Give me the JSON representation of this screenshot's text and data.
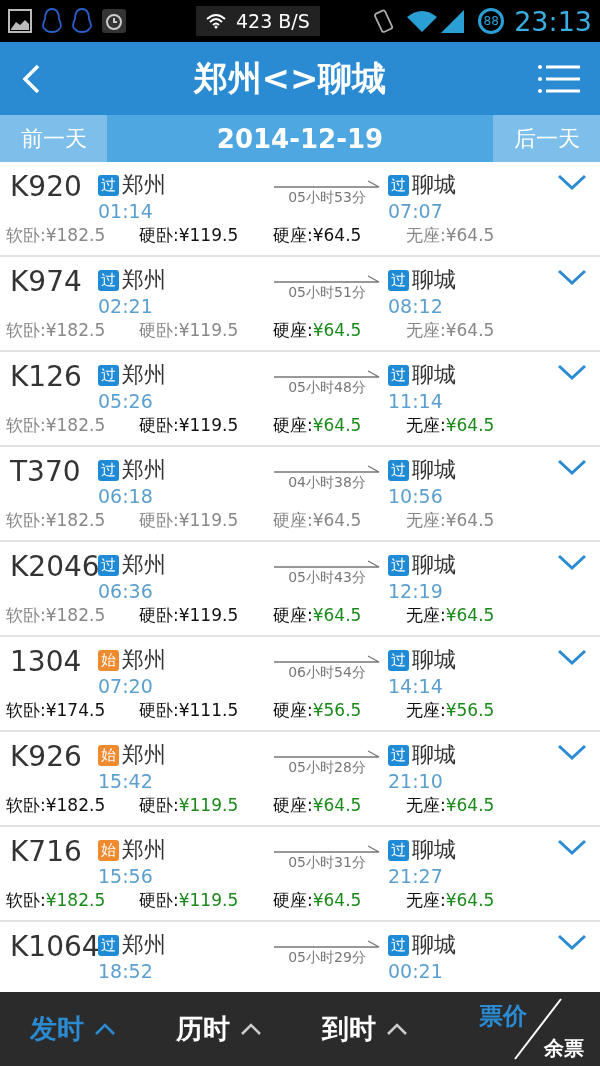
{
  "status_bar": {
    "speed": "423 B/S",
    "battery": "88",
    "time": "23:13"
  },
  "header": {
    "title": "郑州<>聊城"
  },
  "date_bar": {
    "prev": "前一天",
    "date": "2014-12-19",
    "next": "后一天"
  },
  "trains": [
    {
      "number": "K920",
      "from": {
        "badge": "过",
        "kind": "pass",
        "name": "郑州",
        "time": "01:14"
      },
      "duration": "05小时53分",
      "to": {
        "badge": "过",
        "kind": "pass",
        "name": "聊城",
        "time": "07:07"
      },
      "seats": [
        {
          "label": "软卧:",
          "price": "¥182.5",
          "kind": "none"
        },
        {
          "label": "硬卧:",
          "price": "¥119.5",
          "kind": "plain"
        },
        {
          "label": "硬座:",
          "price": "¥64.5",
          "kind": "plain"
        },
        {
          "label": "无座:",
          "price": "¥64.5",
          "kind": "none"
        }
      ]
    },
    {
      "number": "K974",
      "from": {
        "badge": "过",
        "kind": "pass",
        "name": "郑州",
        "time": "02:21"
      },
      "duration": "05小时51分",
      "to": {
        "badge": "过",
        "kind": "pass",
        "name": "聊城",
        "time": "08:12"
      },
      "seats": [
        {
          "label": "软卧:",
          "price": "¥182.5",
          "kind": "none"
        },
        {
          "label": "硬卧:",
          "price": "¥119.5",
          "kind": "none"
        },
        {
          "label": "硬座:",
          "price": "¥64.5",
          "kind": "available"
        },
        {
          "label": "无座:",
          "price": "¥64.5",
          "kind": "none"
        }
      ]
    },
    {
      "number": "K126",
      "from": {
        "badge": "过",
        "kind": "pass",
        "name": "郑州",
        "time": "05:26"
      },
      "duration": "05小时48分",
      "to": {
        "badge": "过",
        "kind": "pass",
        "name": "聊城",
        "time": "11:14"
      },
      "seats": [
        {
          "label": "软卧:",
          "price": "¥182.5",
          "kind": "none"
        },
        {
          "label": "硬卧:",
          "price": "¥119.5",
          "kind": "plain"
        },
        {
          "label": "硬座:",
          "price": "¥64.5",
          "kind": "available"
        },
        {
          "label": "无座:",
          "price": "¥64.5",
          "kind": "available"
        }
      ]
    },
    {
      "number": "T370",
      "from": {
        "badge": "过",
        "kind": "pass",
        "name": "郑州",
        "time": "06:18"
      },
      "duration": "04小时38分",
      "to": {
        "badge": "过",
        "kind": "pass",
        "name": "聊城",
        "time": "10:56"
      },
      "seats": [
        {
          "label": "软卧:",
          "price": "¥182.5",
          "kind": "none"
        },
        {
          "label": "硬卧:",
          "price": "¥119.5",
          "kind": "none"
        },
        {
          "label": "硬座:",
          "price": "¥64.5",
          "kind": "none"
        },
        {
          "label": "无座:",
          "price": "¥64.5",
          "kind": "none"
        }
      ]
    },
    {
      "number": "K2046",
      "from": {
        "badge": "过",
        "kind": "pass",
        "name": "郑州",
        "time": "06:36"
      },
      "duration": "05小时43分",
      "to": {
        "badge": "过",
        "kind": "pass",
        "name": "聊城",
        "time": "12:19"
      },
      "seats": [
        {
          "label": "软卧:",
          "price": "¥182.5",
          "kind": "none"
        },
        {
          "label": "硬卧:",
          "price": "¥119.5",
          "kind": "plain"
        },
        {
          "label": "硬座:",
          "price": "¥64.5",
          "kind": "available"
        },
        {
          "label": "无座:",
          "price": "¥64.5",
          "kind": "available"
        }
      ]
    },
    {
      "number": "1304",
      "from": {
        "badge": "始",
        "kind": "start",
        "name": "郑州",
        "time": "07:20"
      },
      "duration": "06小时54分",
      "to": {
        "badge": "过",
        "kind": "pass",
        "name": "聊城",
        "time": "14:14"
      },
      "seats": [
        {
          "label": "软卧:",
          "price": "¥174.5",
          "kind": "plain"
        },
        {
          "label": "硬卧:",
          "price": "¥111.5",
          "kind": "plain"
        },
        {
          "label": "硬座:",
          "price": "¥56.5",
          "kind": "available"
        },
        {
          "label": "无座:",
          "price": "¥56.5",
          "kind": "available"
        }
      ]
    },
    {
      "number": "K926",
      "from": {
        "badge": "始",
        "kind": "start",
        "name": "郑州",
        "time": "15:42"
      },
      "duration": "05小时28分",
      "to": {
        "badge": "过",
        "kind": "pass",
        "name": "聊城",
        "time": "21:10"
      },
      "seats": [
        {
          "label": "软卧:",
          "price": "¥182.5",
          "kind": "plain"
        },
        {
          "label": "硬卧:",
          "price": "¥119.5",
          "kind": "available"
        },
        {
          "label": "硬座:",
          "price": "¥64.5",
          "kind": "available"
        },
        {
          "label": "无座:",
          "price": "¥64.5",
          "kind": "available"
        }
      ]
    },
    {
      "number": "K716",
      "from": {
        "badge": "始",
        "kind": "start",
        "name": "郑州",
        "time": "15:56"
      },
      "duration": "05小时31分",
      "to": {
        "badge": "过",
        "kind": "pass",
        "name": "聊城",
        "time": "21:27"
      },
      "seats": [
        {
          "label": "软卧:",
          "price": "¥182.5",
          "kind": "available"
        },
        {
          "label": "硬卧:",
          "price": "¥119.5",
          "kind": "available"
        },
        {
          "label": "硬座:",
          "price": "¥64.5",
          "kind": "available"
        },
        {
          "label": "无座:",
          "price": "¥64.5",
          "kind": "available"
        }
      ]
    },
    {
      "number": "K1064",
      "from": {
        "badge": "过",
        "kind": "pass",
        "name": "郑州",
        "time": "18:52"
      },
      "duration": "05小时29分",
      "to": {
        "badge": "过",
        "kind": "pass",
        "name": "聊城",
        "time": "00:21"
      }
    }
  ],
  "sort_bar": [
    {
      "kind": "sort",
      "label": "发时",
      "selected": true
    },
    {
      "kind": "sort",
      "label": "历时",
      "selected": false
    },
    {
      "kind": "sort",
      "label": "到时",
      "selected": false
    },
    {
      "kind": "split",
      "label": "票价",
      "second_label": "余票",
      "selected": false
    }
  ]
}
